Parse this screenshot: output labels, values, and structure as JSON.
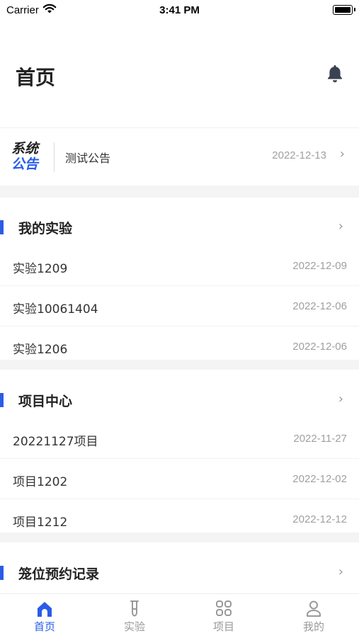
{
  "status_bar": {
    "carrier": "Carrier",
    "time": "3:41 PM"
  },
  "header": {
    "title": "首页",
    "bell_icon": "bell-icon"
  },
  "notice": {
    "logo_line1": "系统",
    "logo_line2": "公告",
    "text": "测试公告",
    "date": "2022-12-13"
  },
  "experiments": {
    "title": "我的实验",
    "items": [
      {
        "name": "实验1209",
        "date": "2022-12-09"
      },
      {
        "name": "实验10061404",
        "date": "2022-12-06"
      },
      {
        "name": "实验1206",
        "date": "2022-12-06"
      }
    ]
  },
  "projects": {
    "title": "项目中心",
    "items": [
      {
        "name": "20221127项目",
        "date": "2022-11-27"
      },
      {
        "name": "项目1202",
        "date": "2022-12-02"
      },
      {
        "name": "项目1212",
        "date": "2022-12-12"
      }
    ]
  },
  "reservations": {
    "title": "笼位预约记录"
  },
  "tabbar": {
    "items": [
      {
        "label": "首页",
        "icon": "home-icon",
        "active": true
      },
      {
        "label": "实验",
        "icon": "test-tube-icon",
        "active": false
      },
      {
        "label": "项目",
        "icon": "grid-icon",
        "active": false
      },
      {
        "label": "我的",
        "icon": "user-icon",
        "active": false
      }
    ]
  },
  "colors": {
    "accent": "#2a5ce8",
    "muted": "#a0a0a0",
    "gap": "#f4f4f4"
  }
}
